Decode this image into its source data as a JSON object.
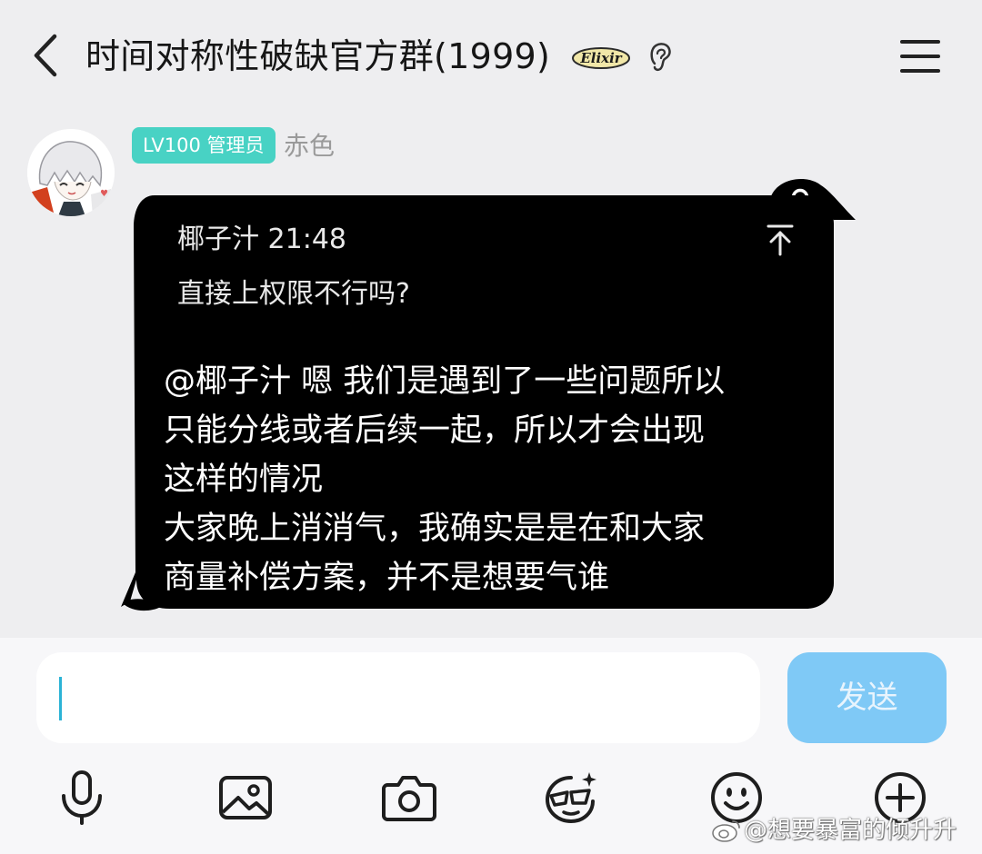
{
  "header": {
    "title": "时间对称性破缺官方群(1999)",
    "badge_text": "Elixir",
    "icons": [
      "back-arrow-icon",
      "ear-icon",
      "menu-icon"
    ]
  },
  "message": {
    "sender_tag": "LV100 管理员",
    "sender_name": "赤色",
    "reply": {
      "author_time": "椰子汁 21:48",
      "text": "直接上权限不行吗?"
    },
    "lines": [
      "@椰子汁 嗯 我们是遇到了一些问题所以",
      "只能分线或者后续一起，所以才会出现",
      "这样的情况",
      "大家晚上消消气，我确实是是在和大家",
      "商量补偿方案，并不是想要气谁"
    ]
  },
  "input": {
    "value": "",
    "send_label": "发送"
  },
  "toolbar": {
    "icons": [
      "microphone-icon",
      "image-icon",
      "camera-icon",
      "sticker-icon",
      "emoji-icon",
      "plus-icon"
    ]
  },
  "watermark": "@想要暴富的倾升升",
  "colors": {
    "tag_bg": "#48d2c4",
    "bubble_bg": "#000000",
    "send_bg": "#7fc9f6",
    "caret": "#2bb3d6"
  }
}
